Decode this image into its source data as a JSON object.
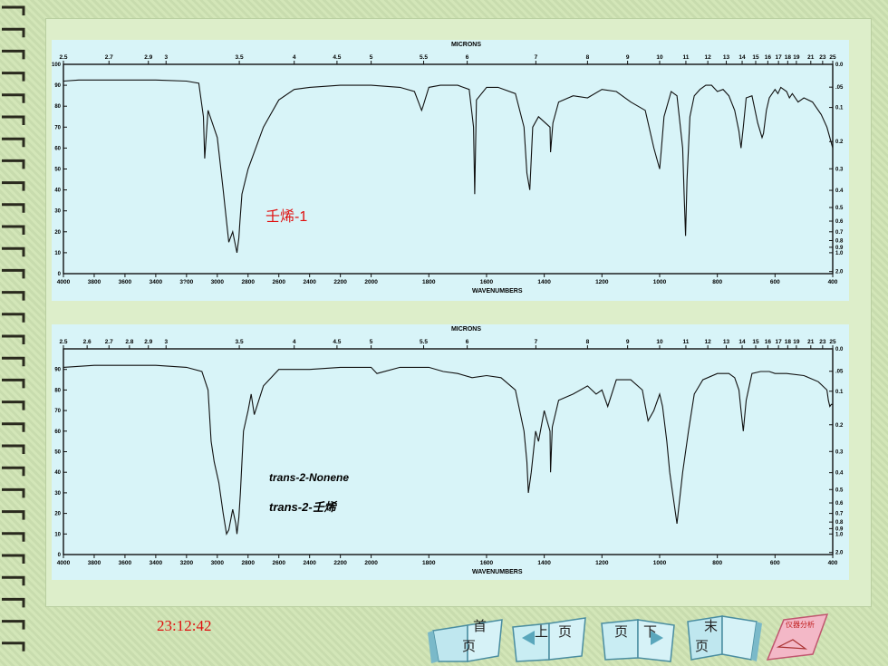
{
  "chart_data": [
    {
      "type": "line",
      "title": "MICRONS",
      "xlabel": "WAVENUMBERS",
      "annotation": "壬烯-1",
      "annotation_color": "#e01010",
      "xlim": [
        4000,
        400
      ],
      "ylim": [
        0,
        100
      ],
      "micron_ticks": [
        "2.5",
        "2.7",
        "2.9",
        "3",
        "3.5",
        "4",
        "4.5",
        "5",
        "5.5",
        "6",
        "7",
        "8",
        "9",
        "10",
        "11",
        "12",
        "13",
        "14",
        "15",
        "16",
        "17",
        "18",
        "19",
        "21",
        "23",
        "25"
      ],
      "micron_wavenumbers": [
        4000,
        3704,
        3448,
        3333,
        2857,
        2500,
        2222,
        2000,
        1818,
        1667,
        1429,
        1250,
        1111,
        1000,
        909,
        833,
        769,
        714,
        667,
        625,
        588,
        556,
        526,
        476,
        435,
        400
      ],
      "wavenumber_ticks": [
        {
          "v": 4000,
          "t": "4000"
        },
        {
          "v": 3800,
          "t": "3800"
        },
        {
          "v": 3600,
          "t": "3600"
        },
        {
          "v": 3400,
          "t": "3400"
        },
        {
          "v": 3200,
          "t": "3?00"
        },
        {
          "v": 3000,
          "t": "3000"
        },
        {
          "v": 2800,
          "t": "2800"
        },
        {
          "v": 2600,
          "t": "2600"
        },
        {
          "v": 2400,
          "t": "2400"
        },
        {
          "v": 2200,
          "t": "2200"
        },
        {
          "v": 2000,
          "t": "2000"
        },
        {
          "v": 1800,
          "t": "1800"
        },
        {
          "v": 1600,
          "t": "1600"
        },
        {
          "v": 1400,
          "t": "1400"
        },
        {
          "v": 1200,
          "t": "1200"
        },
        {
          "v": 1000,
          "t": "1000"
        },
        {
          "v": 800,
          "t": "800"
        },
        {
          "v": 600,
          "t": "600"
        },
        {
          "v": 400,
          "t": "400"
        }
      ],
      "y_ticks": [
        "100",
        "90",
        "80",
        "70",
        "60",
        "50",
        "40",
        "30",
        "20",
        "10",
        "0"
      ],
      "absorbance_ticks": [
        {
          "t": "0.0",
          "y": 100
        },
        {
          "t": ".05",
          "y": 89.1
        },
        {
          "t": "0.1",
          "y": 79.4
        },
        {
          "t": "0.2",
          "y": 63.1
        },
        {
          "t": "0.3",
          "y": 50.1
        },
        {
          "t": "0.4",
          "y": 39.8
        },
        {
          "t": "0.5",
          "y": 31.6
        },
        {
          "t": "0.6",
          "y": 25.1
        },
        {
          "t": "0.7",
          "y": 20.0
        },
        {
          "t": "0.8",
          "y": 15.8
        },
        {
          "t": "0.9",
          "y": 12.6
        },
        {
          "t": "1.0",
          "y": 10.0
        },
        {
          "t": "2.0",
          "y": 1.0
        }
      ],
      "series": [
        {
          "x": [
            4000,
            3900,
            3800,
            3600,
            3400,
            3200,
            3120,
            3090,
            3082,
            3060,
            3000,
            2962,
            2940,
            2925,
            2900,
            2872,
            2860,
            2853,
            2840,
            2800,
            2700,
            2600,
            2500,
            2400,
            2200,
            2000,
            1900,
            1850,
            1825,
            1820,
            1800,
            1760,
            1700,
            1660,
            1645,
            1641,
            1635,
            1600,
            1560,
            1500,
            1470,
            1460,
            1450,
            1440,
            1420,
            1380,
            1378,
            1370,
            1350,
            1300,
            1250,
            1200,
            1150,
            1100,
            1050,
            1020,
            1000,
            995,
            985,
            960,
            940,
            920,
            915,
            910,
            905,
            895,
            880,
            860,
            840,
            820,
            800,
            780,
            760,
            740,
            725,
            718,
            710,
            700,
            680,
            660,
            645,
            640,
            630,
            620,
            600,
            590,
            580,
            560,
            550,
            540,
            520,
            500,
            470,
            440,
            420,
            410,
            400
          ],
          "y": [
            92,
            92.5,
            92.5,
            92.5,
            92.5,
            92,
            91,
            75,
            55,
            78,
            65,
            40,
            25,
            15,
            20,
            10,
            17,
            25,
            38,
            50,
            70,
            83,
            88,
            89,
            90,
            90,
            89,
            87,
            78,
            80,
            89,
            90,
            90,
            88,
            70,
            38,
            83,
            89,
            89,
            86,
            70,
            48,
            40,
            70,
            75,
            70,
            58,
            72,
            82,
            85,
            84,
            88,
            87,
            82,
            78,
            60,
            50,
            58,
            75,
            87,
            85,
            60,
            38,
            18,
            45,
            75,
            85,
            88,
            90,
            90,
            87,
            88,
            85,
            78,
            68,
            60,
            70,
            84,
            85,
            72,
            65,
            67,
            78,
            84,
            88,
            86,
            89,
            87,
            84,
            86,
            82,
            84,
            82,
            76,
            70,
            65,
            60
          ]
        }
      ]
    },
    {
      "type": "line",
      "title": "MICRONS",
      "xlabel": "WAVENUMBERS",
      "annotation_en": "trans-2-Nonene",
      "annotation_cn_prefix": "trans-2-",
      "annotation_cn": "壬烯",
      "xlim": [
        4000,
        400
      ],
      "ylim": [
        0,
        100
      ],
      "micron_ticks": [
        "2.5",
        "2.6",
        "2.7",
        "2.8",
        "2.9",
        "3",
        "3.5",
        "4",
        "4.5",
        "5",
        "5.5",
        "6",
        "7",
        "8",
        "9",
        "10",
        "11",
        "12",
        "13",
        "14",
        "15",
        "16",
        "17",
        "18",
        "19",
        "21",
        "23",
        "25"
      ],
      "micron_wavenumbers": [
        4000,
        3846,
        3704,
        3571,
        3448,
        3333,
        2857,
        2500,
        2222,
        2000,
        1818,
        1667,
        1429,
        1250,
        1111,
        1000,
        909,
        833,
        769,
        714,
        667,
        625,
        588,
        556,
        526,
        476,
        435,
        400
      ],
      "wavenumber_ticks": [
        {
          "v": 4000,
          "t": "4000"
        },
        {
          "v": 3800,
          "t": "3800"
        },
        {
          "v": 3600,
          "t": "3600"
        },
        {
          "v": 3400,
          "t": "3400"
        },
        {
          "v": 3200,
          "t": "3200"
        },
        {
          "v": 3000,
          "t": "3000"
        },
        {
          "v": 2800,
          "t": "2800"
        },
        {
          "v": 2600,
          "t": "2600"
        },
        {
          "v": 2400,
          "t": "2400"
        },
        {
          "v": 2200,
          "t": "2200"
        },
        {
          "v": 2000,
          "t": "2000"
        },
        {
          "v": 1800,
          "t": "1800"
        },
        {
          "v": 1600,
          "t": "1600"
        },
        {
          "v": 1400,
          "t": "1400"
        },
        {
          "v": 1200,
          "t": "1200"
        },
        {
          "v": 1000,
          "t": "1000"
        },
        {
          "v": 800,
          "t": "800"
        },
        {
          "v": 600,
          "t": "600"
        },
        {
          "v": 400,
          "t": "400"
        }
      ],
      "y_ticks": [
        "90",
        "80",
        "70",
        "60",
        "50",
        "40",
        "30",
        "20",
        "10",
        "0"
      ],
      "absorbance_ticks": [
        {
          "t": "0.0",
          "y": 100
        },
        {
          "t": ".05",
          "y": 89.1
        },
        {
          "t": "0.1",
          "y": 79.4
        },
        {
          "t": "0.2",
          "y": 63.1
        },
        {
          "t": "0.3",
          "y": 50.1
        },
        {
          "t": "0.4",
          "y": 39.8
        },
        {
          "t": "0.5",
          "y": 31.6
        },
        {
          "t": "0.6",
          "y": 25.1
        },
        {
          "t": "0.7",
          "y": 20.0
        },
        {
          "t": "0.8",
          "y": 15.8
        },
        {
          "t": "0.9",
          "y": 12.6
        },
        {
          "t": "1.0",
          "y": 10.0
        },
        {
          "t": "2.0",
          "y": 1.0
        }
      ],
      "series": [
        {
          "x": [
            4000,
            3900,
            3800,
            3600,
            3400,
            3200,
            3100,
            3060,
            3040,
            3020,
            2990,
            2962,
            2940,
            2925,
            2900,
            2880,
            2872,
            2860,
            2850,
            2830,
            2800,
            2780,
            2760,
            2700,
            2600,
            2400,
            2200,
            2000,
            1980,
            1900,
            1800,
            1750,
            1700,
            1650,
            1600,
            1550,
            1500,
            1470,
            1460,
            1455,
            1445,
            1430,
            1420,
            1400,
            1380,
            1378,
            1372,
            1350,
            1300,
            1250,
            1220,
            1200,
            1180,
            1150,
            1100,
            1060,
            1040,
            1020,
            1000,
            990,
            975,
            965,
            950,
            940,
            920,
            900,
            880,
            850,
            800,
            760,
            740,
            725,
            718,
            710,
            700,
            680,
            650,
            620,
            600,
            560,
            500,
            450,
            420,
            415,
            410,
            405,
            400
          ],
          "y": [
            91,
            91.5,
            92,
            92,
            92,
            91,
            89,
            80,
            55,
            45,
            35,
            20,
            10,
            12,
            22,
            15,
            10,
            18,
            30,
            60,
            70,
            78,
            68,
            82,
            90,
            90,
            91,
            91,
            88,
            91,
            91,
            89,
            88,
            86,
            87,
            86,
            80,
            60,
            45,
            30,
            40,
            60,
            55,
            70,
            60,
            40,
            62,
            75,
            78,
            82,
            78,
            80,
            72,
            85,
            85,
            80,
            65,
            70,
            78,
            72,
            55,
            40,
            25,
            15,
            40,
            60,
            78,
            85,
            88,
            88,
            86,
            80,
            70,
            60,
            75,
            88,
            89,
            89,
            88,
            88,
            87,
            84,
            80,
            75,
            72,
            73,
            73
          ]
        }
      ]
    }
  ],
  "footer": {
    "time": "23:12:42",
    "nav": [
      {
        "top": "首",
        "bottom": "页"
      },
      {
        "left": "上",
        "right": "页"
      },
      {
        "left": "页",
        "right": "下"
      },
      {
        "top": "末",
        "bottom": "页"
      },
      {
        "label": "仪器分析"
      }
    ]
  }
}
